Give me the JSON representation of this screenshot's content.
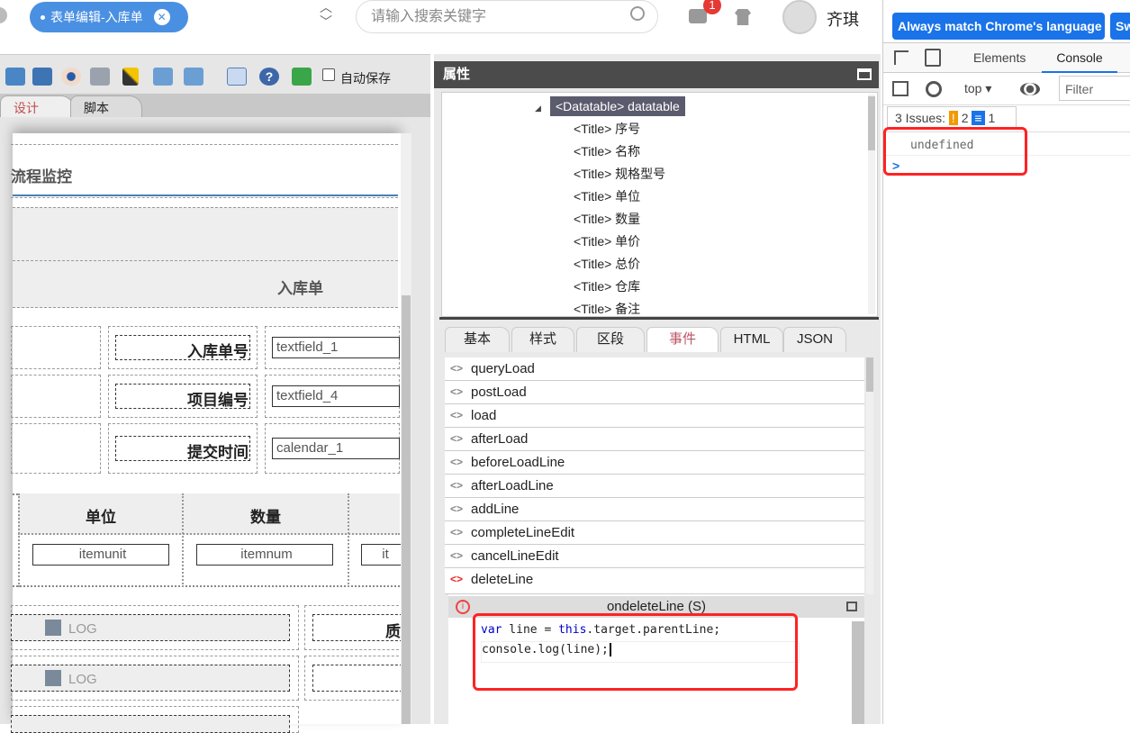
{
  "topbar": {
    "tab_label": "表单编辑-入库单",
    "search_placeholder": "请输入搜索关键字",
    "notification_count": "1",
    "user_name": "齐琪"
  },
  "toolbar": {
    "autosave_label": "自动保存"
  },
  "editor_tabs": [
    "设计",
    "脚本"
  ],
  "form": {
    "section_title": "流程监控",
    "form_title": "入库单",
    "fields": [
      {
        "label": "入库单号",
        "value": "textfield_1"
      },
      {
        "label": "项目编号",
        "value": "textfield_4"
      },
      {
        "label": "提交时间",
        "value": "calendar_1"
      }
    ],
    "table_headers": [
      "单位",
      "数量"
    ],
    "table_cells": [
      "itemunit",
      "itemnum",
      "it"
    ],
    "log_label": "LOG",
    "partial_label": "质"
  },
  "properties": {
    "title": "属性",
    "tree": {
      "root": "<Datatable> datatable",
      "children": [
        "<Title> 序号",
        "<Title> 名称",
        "<Title> 规格型号",
        "<Title> 单位",
        "<Title> 数量",
        "<Title> 单价",
        "<Title> 总价",
        "<Title> 仓库",
        "<Title> 备注"
      ]
    },
    "tabs": [
      "基本",
      "样式",
      "区段",
      "事件",
      "HTML",
      "JSON"
    ],
    "active_tab": "事件",
    "events": [
      "queryLoad",
      "postLoad",
      "load",
      "afterLoad",
      "beforeLoadLine",
      "afterLoadLine",
      "addLine",
      "completeLineEdit",
      "cancelLineEdit",
      "deleteLine"
    ],
    "editor": {
      "title": "ondeleteLine (S)",
      "line1_kw": "var",
      "line1_a": " line = ",
      "line1_kw2": "this",
      "line1_b": ".target.parentLine;",
      "line2": "console.log(line);"
    }
  },
  "devtools": {
    "lang_button": "Always match Chrome's language",
    "switch_button": "Switch",
    "tabs": [
      "Elements",
      "Console"
    ],
    "context": "top",
    "filter_placeholder": "Filter",
    "issues_label": "3 Issues:",
    "issues_warn": "2",
    "issues_info": "1",
    "output": "undefined",
    "prompt": ">"
  },
  "colors": {
    "accent": "#4a90e2",
    "highlight": "#ff2222",
    "devtools_blue": "#1a73e8"
  }
}
